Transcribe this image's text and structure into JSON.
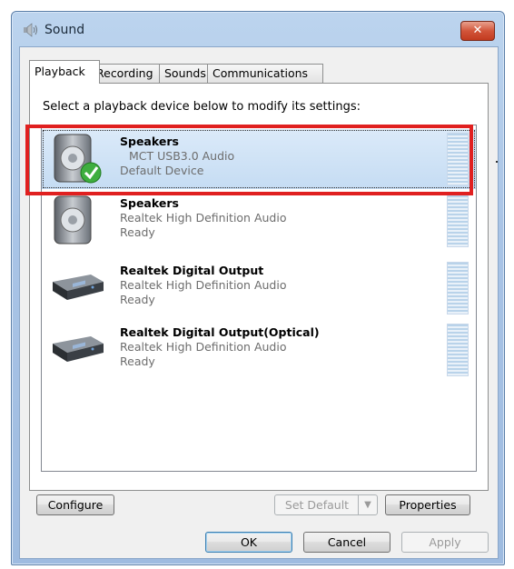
{
  "window": {
    "title": "Sound",
    "close_label": "✕"
  },
  "tabs": [
    {
      "label": "Playback",
      "active": true
    },
    {
      "label": "Recording",
      "active": false
    },
    {
      "label": "Sounds",
      "active": false
    },
    {
      "label": "Communications",
      "active": false
    }
  ],
  "instruction": "Select a playback device below to modify its settings:",
  "devices": [
    {
      "name": "Speakers",
      "description": "MCT USB3.0 Audio",
      "status": "Default Device",
      "icon": "speaker-icon",
      "selected": true,
      "default": true
    },
    {
      "name": "Speakers",
      "description": "Realtek High Definition Audio",
      "status": "Ready",
      "icon": "speaker-icon",
      "selected": false
    },
    {
      "name": "Realtek Digital Output",
      "description": "Realtek High Definition Audio",
      "status": "Ready",
      "icon": "digital-output-icon",
      "selected": false
    },
    {
      "name": "Realtek Digital Output(Optical)",
      "description": "Realtek High Definition Audio",
      "status": "Ready",
      "icon": "digital-output-icon",
      "selected": false
    }
  ],
  "buttons": {
    "configure": "Configure",
    "set_default": "Set Default",
    "properties": "Properties",
    "ok": "OK",
    "cancel": "Cancel",
    "apply": "Apply"
  },
  "colors": {
    "highlight": "#e02020",
    "selection": "#c5dcf3",
    "accent": "#3c7fb1"
  }
}
